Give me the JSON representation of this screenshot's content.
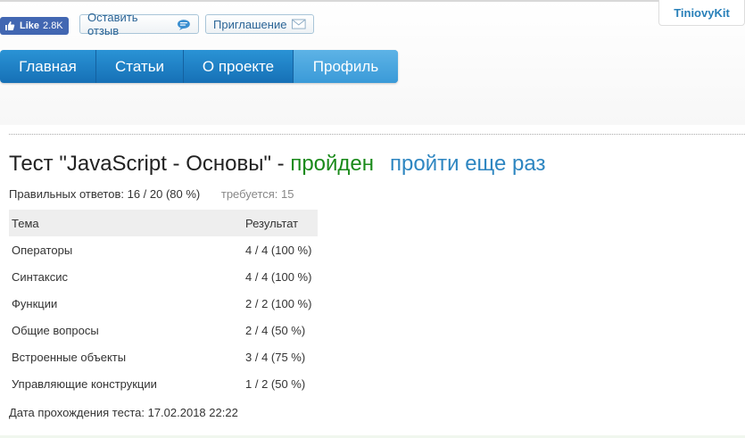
{
  "social": {
    "like_label": "Like",
    "like_count": "2.8K"
  },
  "header": {
    "feedback_label": "Оставить отзыв",
    "invite_label": "Приглашение",
    "brand": "TiniovyKit"
  },
  "nav": {
    "items": [
      {
        "label": "Главная"
      },
      {
        "label": "Статьи"
      },
      {
        "label": "О проекте"
      },
      {
        "label": "Профиль",
        "active": true
      }
    ]
  },
  "test": {
    "title": "Тест \"JavaScript - Основы\" - ",
    "status": "пройден",
    "retry_link": "пройти еще раз",
    "correct_answers": "Правильных ответов: 16 / 20 (80 %)",
    "required": "требуется: 15",
    "table": {
      "headers": [
        "Тема",
        "Результат"
      ],
      "rows": [
        [
          "Операторы",
          "4 / 4 (100 %)"
        ],
        [
          "Синтаксис",
          "4 / 4 (100 %)"
        ],
        [
          "Функции",
          "2 / 2 (100 %)"
        ],
        [
          "Общие вопросы",
          "2 / 4 (50 %)"
        ],
        [
          "Встроенные объекты",
          "3 / 4 (75 %)"
        ],
        [
          "Управляющие конструкции",
          "1 / 2 (50 %)"
        ]
      ]
    },
    "completion_date": "Дата прохождения теста: 17.02.2018 22:22"
  },
  "colors": {
    "nav": "#1f82c8",
    "passed": "#1a8a1a",
    "link": "#2e86c1",
    "facebook": "#4267b2"
  }
}
